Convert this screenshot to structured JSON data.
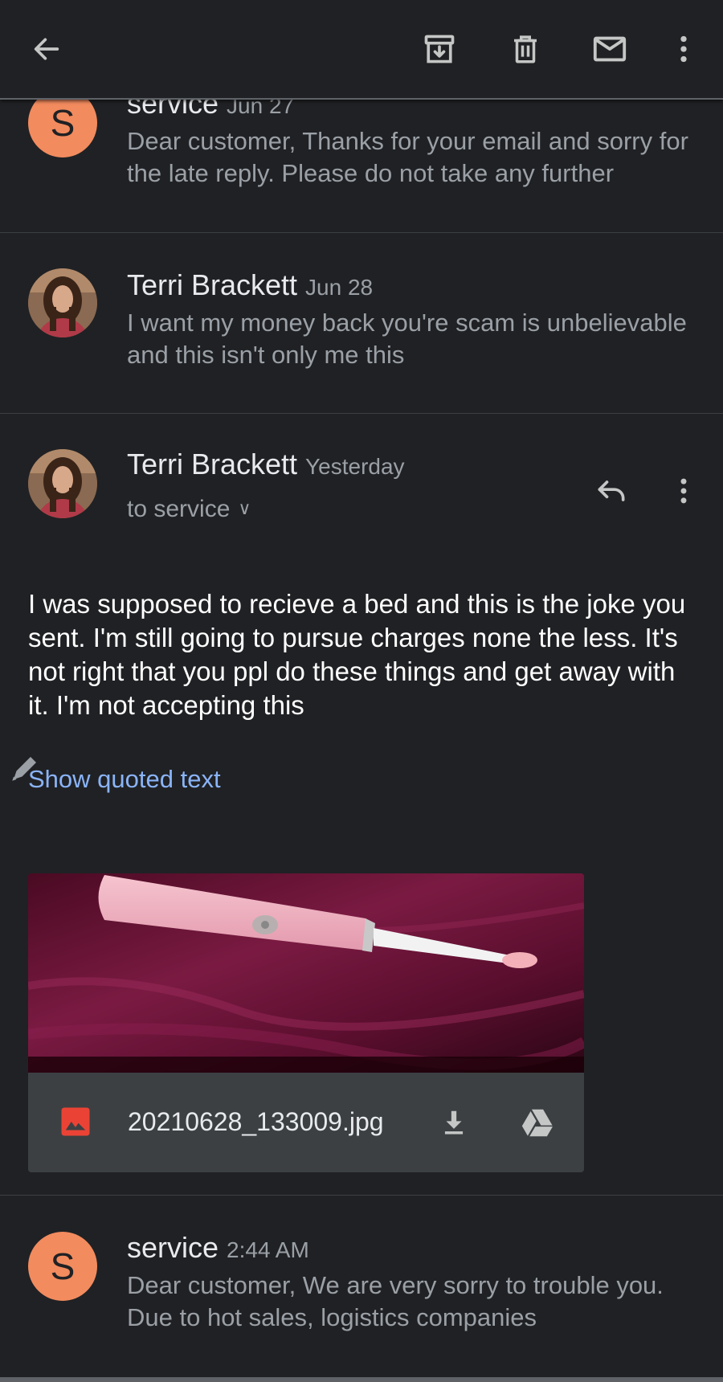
{
  "appbar": {
    "back_icon": "arrow-back-icon",
    "archive_icon": "archive-icon",
    "delete_icon": "trash-icon",
    "mark_unread_icon": "mail-icon",
    "more_icon": "more-vert-icon"
  },
  "messages": [
    {
      "sender": "service",
      "date": "Jun 27",
      "avatar_letter": "S",
      "snippet": "Dear customer, Thanks for your email and sorry for the late reply. Please do not take any further"
    },
    {
      "sender": "Terri Brackett",
      "date": "Jun 28",
      "snippet": "I want my money back you're scam is unbelievable and this isn't only me this"
    },
    {
      "sender": "Terri Brackett",
      "date": "Yesterday",
      "to": "to service",
      "body": "I was supposed to recieve a bed and this is the joke you sent. I'm still going to pursue charges none the less. It's not right that you ppl do these things and get away with it. I'm not accepting this",
      "show_quoted": "Show quoted text",
      "attachment": {
        "filename": "20210628_133009.jpg"
      }
    },
    {
      "sender": "service",
      "date": "2:44 AM",
      "avatar_letter": "S",
      "snippet": "Dear customer, We are very sorry to trouble you. Due to hot sales, logistics companies"
    }
  ],
  "colors": {
    "background": "#202124",
    "avatar_orange": "#f28b5e",
    "link_blue": "#8ab4f8",
    "attachment_icon_red": "#ea4335"
  }
}
